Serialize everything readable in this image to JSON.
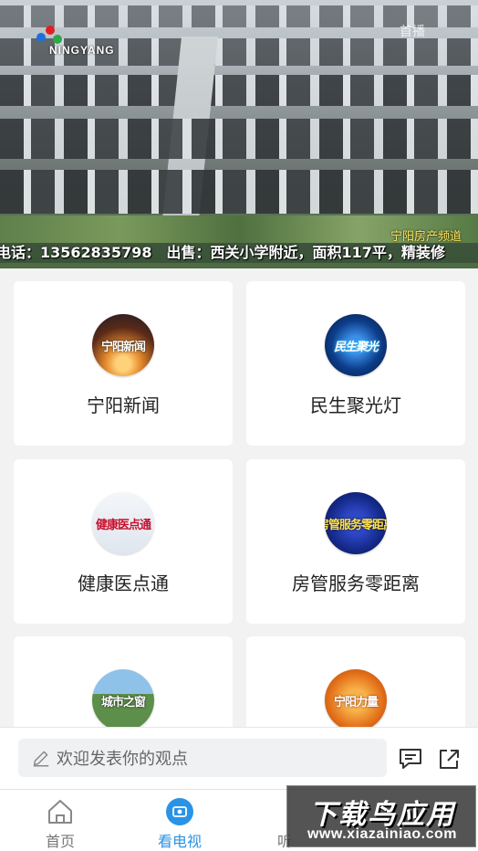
{
  "video": {
    "logo_text": "NINGYANG",
    "corner_watermark": "首播",
    "caption_right": "宁阳房产频道",
    "ticker": "电话：13562835798　出售：西关小学附近，面积117平，精装修"
  },
  "programs": [
    {
      "label": "宁阳新闻",
      "thumb_text": "宁阳新闻"
    },
    {
      "label": "民生聚光灯",
      "thumb_text": "民生聚光"
    },
    {
      "label": "健康医点通",
      "thumb_text": "健康医点通"
    },
    {
      "label": "房管服务零距离",
      "thumb_text": "房管服务零距离"
    },
    {
      "label": "",
      "thumb_text": "城市之窗"
    },
    {
      "label": "",
      "thumb_text": "宁阳力量"
    }
  ],
  "comment": {
    "placeholder": "欢迎发表你的观点",
    "comment_icon": "comment-icon",
    "share_icon": "share-icon"
  },
  "tabs": [
    {
      "label": "首页",
      "icon": "home-icon",
      "active": false
    },
    {
      "label": "看电视",
      "icon": "tv-icon",
      "active": true
    },
    {
      "label": "听",
      "icon": "radio-icon",
      "active": false
    }
  ],
  "site_watermark": {
    "title": "下载鸟应用",
    "url": "www.xiazainiao.com"
  },
  "colors": {
    "accent": "#2b93e6",
    "background": "#f2f2f2"
  }
}
